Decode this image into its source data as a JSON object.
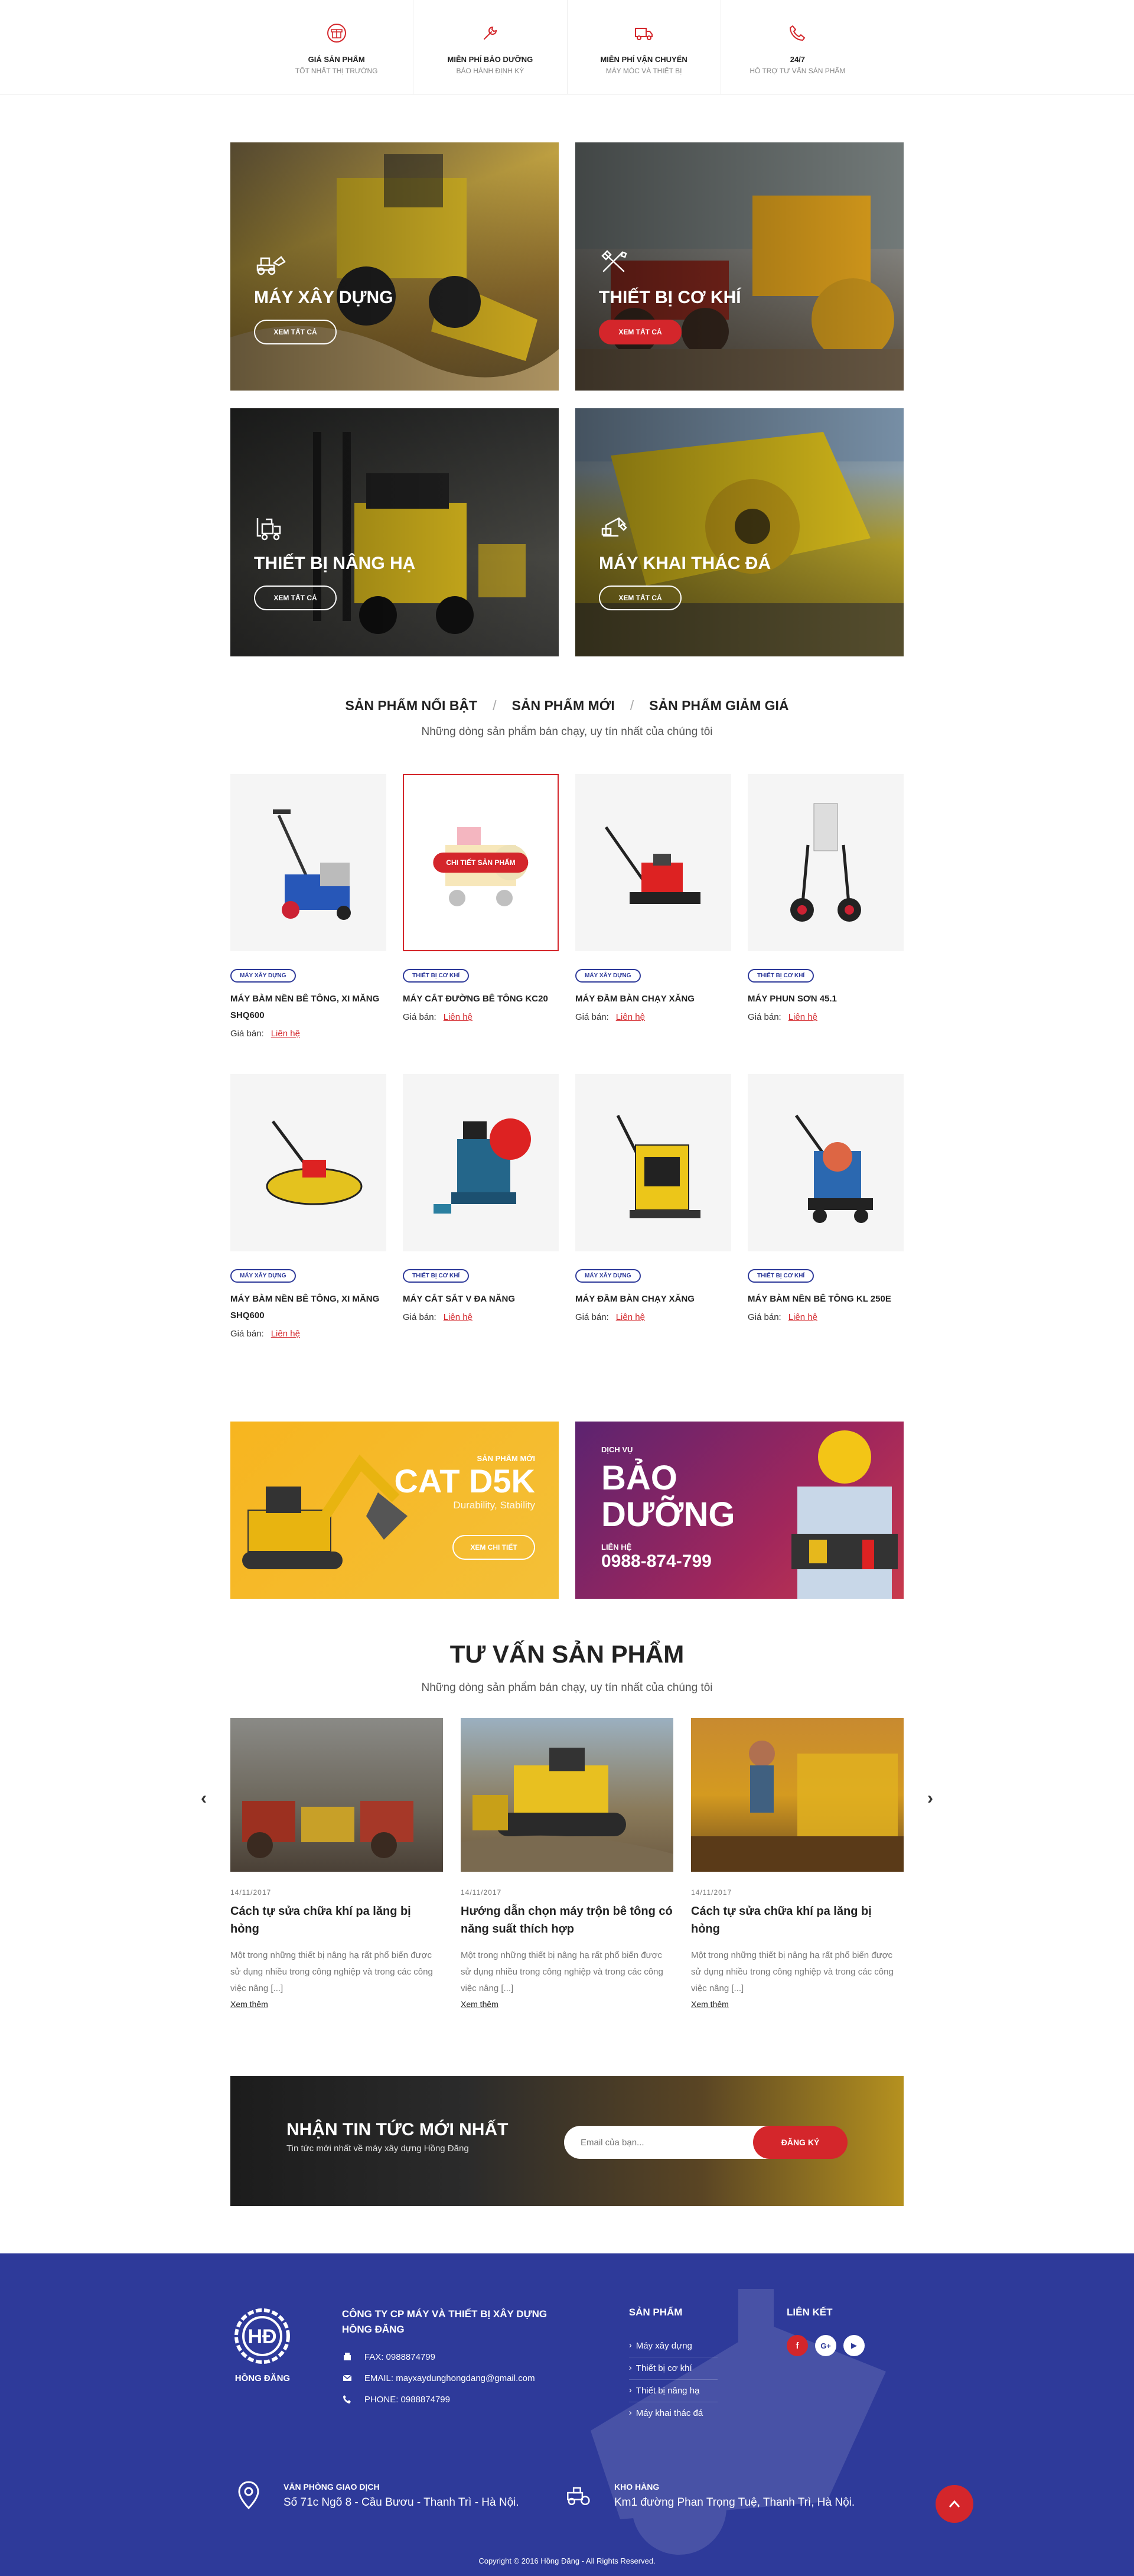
{
  "features": [
    {
      "icon": "gift-icon",
      "title": "GIÁ SẢN PHẨM",
      "subtitle": "TỐT NHẤT THỊ TRƯỜNG"
    },
    {
      "icon": "wrench-icon",
      "title": "MIỄN PHÍ BẢO DƯỠNG",
      "subtitle": "BẢO HÀNH ĐỊNH KỲ"
    },
    {
      "icon": "truck-icon",
      "title": "MIỄN PHÍ VẬN CHUYỂN",
      "subtitle": "MÁY MÓC VÀ THIẾT BỊ"
    },
    {
      "icon": "phone-icon",
      "title": "24/7",
      "subtitle": "HỖ TRỢ TƯ VẤN SẢN PHẨM"
    }
  ],
  "categories": [
    {
      "title": "MÁY XÂY DỰNG",
      "button": "XEM TẤT CẢ",
      "icon": "loader-icon"
    },
    {
      "title": "THIẾT BỊ CƠ KHÍ",
      "button": "XEM TẤT CẢ",
      "icon": "tools-icon"
    },
    {
      "title": "THIẾT BỊ NÂNG HẠ",
      "button": "XEM TẤT CẢ",
      "icon": "forklift-icon"
    },
    {
      "title": "MÁY KHAI THÁC ĐÁ",
      "button": "XEM TẤT CẢ",
      "icon": "crane-icon"
    }
  ],
  "tabs": {
    "items": [
      "SẢN PHẨM NỔI BẬT",
      "SẢN PHẨM MỚI",
      "SẢN PHẨM GIẢM GIÁ"
    ],
    "separator": "/",
    "subtitle": "Những dòng sản phẩm bán chạy, uy tín nhất của chúng tôi"
  },
  "products": [
    {
      "tag": "MÁY XÂY DỰNG",
      "name": "MÁY BÀM NỀN BÊ TÔNG, XI MĂNG SHQ600",
      "price_label": "Giá bán:",
      "price": "Liên hệ"
    },
    {
      "tag": "THIẾT BỊ CƠ KHÍ",
      "name": "MÁY CẮT ĐƯỜNG BÊ TÔNG KC20",
      "price_label": "Giá bán:",
      "price": "Liên hệ",
      "overlay": "CHI TIẾT SẢN PHẨM"
    },
    {
      "tag": "MÁY XÂY DỰNG",
      "name": "MÁY ĐẦM BÀN CHẠY XĂNG",
      "price_label": "Giá bán:",
      "price": "Liên hệ"
    },
    {
      "tag": "THIẾT BỊ CƠ KHÍ",
      "name": "MÁY PHUN SƠN 45.1",
      "price_label": "Giá bán:",
      "price": "Liên hệ"
    },
    {
      "tag": "MÁY XÂY DỰNG",
      "name": "MÁY BÀM NỀN BÊ TÔNG, XI MĂNG SHQ600",
      "price_label": "Giá bán:",
      "price": "Liên hệ"
    },
    {
      "tag": "THIẾT BỊ CƠ KHÍ",
      "name": "MÁY CẮT SẮT V ĐA NĂNG",
      "price_label": "Giá bán:",
      "price": "Liên hệ"
    },
    {
      "tag": "MÁY XÂY DỰNG",
      "name": "MÁY ĐẦM BÀN CHẠY XĂNG",
      "price_label": "Giá bán:",
      "price": "Liên hệ"
    },
    {
      "tag": "THIẾT BỊ CƠ KHÍ",
      "name": "MÁY BÀM NỀN BÊ TÔNG KL 250E",
      "price_label": "Giá bán:",
      "price": "Liên hệ"
    }
  ],
  "promo_cat": {
    "small": "SẢN PHẨM MỚI",
    "big": "CAT D5K",
    "mid": "Durability, Stability",
    "button": "XEM CHI TIẾT"
  },
  "promo_service": {
    "small": "DỊCH VỤ",
    "big_line1": "BẢO",
    "big_line2": "DƯỠNG",
    "contact_label": "LIÊN HỆ",
    "phone": "0988-874-799"
  },
  "consult": {
    "title": "TƯ VẤN SẢN PHẨM",
    "subtitle": "Những dòng sản phẩm bán chạy, uy tín nhất của chúng tôi",
    "prev": "‹",
    "next": "›",
    "posts": [
      {
        "date": "14/11/2017",
        "title": "Cách tự sửa chữa khí pa lăng bị hỏng",
        "excerpt": "Một trong những thiết bị nâng hạ rất phổ biến được sử dụng nhiều trong công nghiệp và trong các công việc nâng [...]",
        "more": "Xem thêm"
      },
      {
        "date": "14/11/2017",
        "title": "Hướng dẫn chọn máy trộn bê tông có năng suất thích hợp",
        "excerpt": "Một trong những thiết bị nâng hạ rất phổ biến được sử dụng nhiều trong công nghiệp và trong các công việc nâng [...]",
        "more": "Xem thêm"
      },
      {
        "date": "14/11/2017",
        "title": "Cách tự sửa chữa khí pa lăng bị hỏng",
        "excerpt": "Một trong những thiết bị nâng hạ rất phổ biến được sử dụng nhiều trong công nghiệp và trong các công việc nâng [...]",
        "more": "Xem thêm"
      }
    ]
  },
  "newsletter": {
    "title": "NHẬN TIN TỨC MỚI NHẤT",
    "subtitle": "Tin tức mới nhất về máy xây dựng Hồng Đăng",
    "placeholder": "Email của bạn...",
    "button": "ĐĂNG KÝ"
  },
  "footer": {
    "logo_text": "HỒNG ĐĂNG",
    "company": "CÔNG TY CP MÁY VÀ THIẾT BỊ XÂY DỰNG HỒNG ĐĂNG",
    "fax": "FAX:  0988874799",
    "email": "EMAIL:  mayxaydunghongdang@gmail.com",
    "phone": "PHONE:  0988874799",
    "products_heading": "SẢN PHẨM",
    "product_links": [
      "Máy xây dựng",
      "Thiết bị cơ khí",
      "Thiết bị nâng hạ",
      "Máy khai thác đá"
    ],
    "links_heading": "LIÊN KẾT",
    "socials": [
      {
        "name": "facebook-icon",
        "glyph": "f",
        "bg": "#d4262b",
        "fg": "#ffffff"
      },
      {
        "name": "google-plus-icon",
        "glyph": "G+",
        "bg": "#ffffff",
        "fg": "#2e3a9a"
      },
      {
        "name": "youtube-icon",
        "glyph": "▶",
        "bg": "#ffffff",
        "fg": "#2e3a9a"
      }
    ],
    "office_label": "VĂN PHÒNG GIAO DỊCH",
    "office_address": "Số 71c Ngõ 8 - Cầu Bươu - Thanh Trì - Hà Nội.",
    "warehouse_label": "KHO HÀNG",
    "warehouse_address": "Km1 đường Phan Trọng Tuệ, Thanh Trì, Hà Nội.",
    "copyright": "Copyright © 2016 Hồng Đăng - All Rights Reserved."
  },
  "colors": {
    "accent_red": "#d4262b",
    "brand_blue": "#2e3a9a"
  }
}
